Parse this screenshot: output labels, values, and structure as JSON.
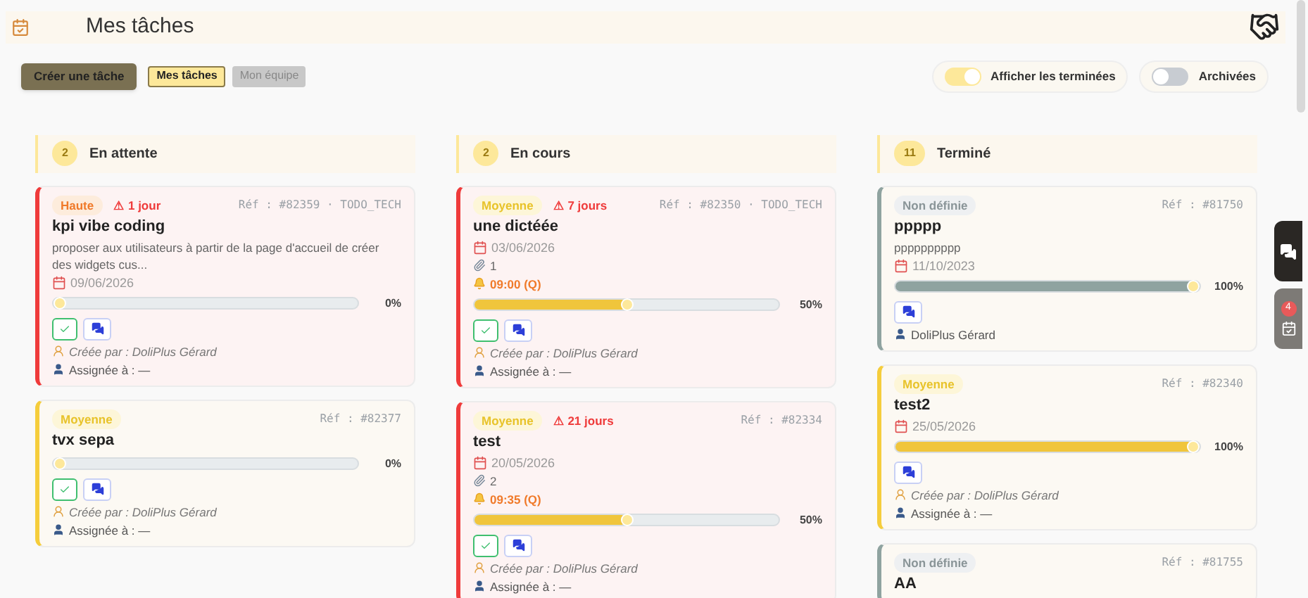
{
  "header": {
    "title": "Mes tâches"
  },
  "toolbar": {
    "create_button": "Créer une tâche",
    "tabs": [
      {
        "label": "Mes tâches",
        "selected": true
      },
      {
        "label": "Mon équipe",
        "selected": false
      }
    ]
  },
  "toggles": [
    {
      "label": "Afficher les terminées",
      "on": true
    },
    {
      "label": "Archivées",
      "on": false
    }
  ],
  "columns": [
    {
      "count": "2",
      "title": "En attente",
      "cards": [
        {
          "priority": {
            "label": "Haute",
            "kind": "high"
          },
          "overdue": "⚠ 1 jour",
          "ref": "Réf : #82359 · TODO_TECH",
          "title": "kpi vibe coding",
          "description": "proposer aux utilisateurs à partir de la page d'accueil de créer des widgets cus...",
          "date": "09/06/2026",
          "level": 0,
          "percent": "0%",
          "done_button": true,
          "created_by": "Créée par : DoliPlus Gérard",
          "assigned": "Assignée à : —"
        },
        {
          "priority": {
            "label": "Moyenne",
            "kind": "medium"
          },
          "ref": "Réf : #82377",
          "title": "tvx sepa",
          "level": 0,
          "percent": "0%",
          "done_button": true,
          "created_by": "Créée par : DoliPlus Gérard",
          "assigned": "Assignée à : —"
        }
      ]
    },
    {
      "count": "2",
      "title": "En cours",
      "cards": [
        {
          "priority": {
            "label": "Moyenne",
            "kind": "medium"
          },
          "overdue": "⚠ 7 jours",
          "ref": "Réf : #82350 · TODO_TECH",
          "title": "une dictéée",
          "date": "03/06/2026",
          "attachments": "1",
          "reminder": "09:00 (Q)",
          "level": 0.5,
          "percent": "50%",
          "done_button": true,
          "created_by": "Créée par : DoliPlus Gérard",
          "assigned": "Assignée à : —"
        },
        {
          "priority": {
            "label": "Moyenne",
            "kind": "medium"
          },
          "overdue": "⚠ 21 jours",
          "ref": "Réf : #82334",
          "title": "test",
          "date": "20/05/2026",
          "attachments": "2",
          "reminder": "09:35 (Q)",
          "level": 0.5,
          "percent": "50%",
          "done_button": true,
          "created_by": "Créée par : DoliPlus Gérard",
          "assigned": "Assignée à : —"
        }
      ]
    },
    {
      "count": "11",
      "title": "Terminé",
      "cards": [
        {
          "priority": {
            "label": "Non définie",
            "kind": "none"
          },
          "ref": "Réf : #81750",
          "title": "ppppp",
          "description": "pppppppppp",
          "date": "11/10/2023",
          "level": 1,
          "percent": "100%",
          "done_button": false,
          "assigned": "DoliPlus Gérard"
        },
        {
          "priority": {
            "label": "Moyenne",
            "kind": "medium"
          },
          "ref": "Réf : #82340",
          "title": "test2",
          "date": "25/05/2026",
          "level": 1,
          "percent": "100%",
          "done_button": false,
          "created_by": "Créée par : DoliPlus Gérard",
          "assigned": "Assignée à : —"
        },
        {
          "priority": {
            "label": "Non définie",
            "kind": "none"
          },
          "ref": "Réf : #81755",
          "title": "AA"
        }
      ]
    }
  ],
  "side_tabs": {
    "calendar_badge": "4"
  }
}
